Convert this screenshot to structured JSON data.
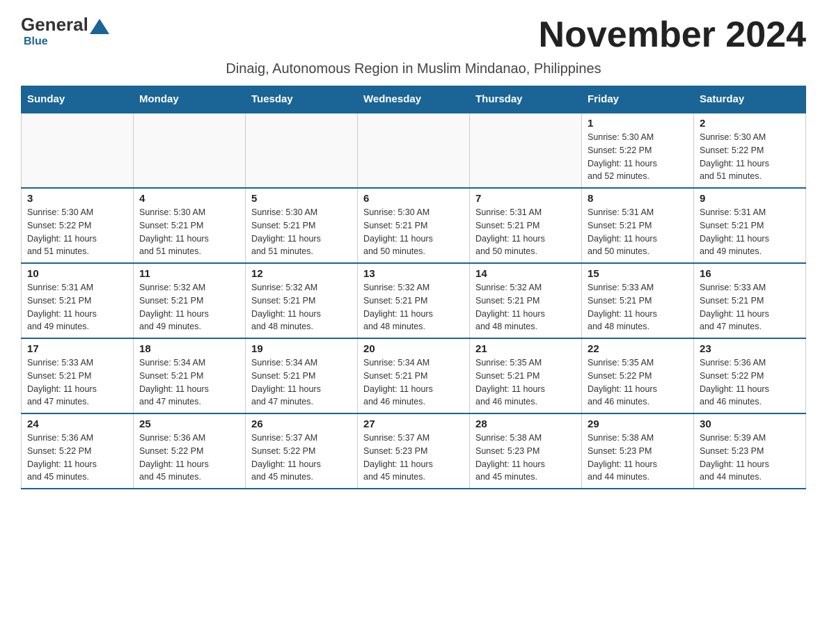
{
  "logo": {
    "general": "General",
    "blue": "Blue"
  },
  "title": "November 2024",
  "subtitle": "Dinaig, Autonomous Region in Muslim Mindanao, Philippines",
  "weekdays": [
    "Sunday",
    "Monday",
    "Tuesday",
    "Wednesday",
    "Thursday",
    "Friday",
    "Saturday"
  ],
  "weeks": [
    [
      {
        "day": "",
        "info": ""
      },
      {
        "day": "",
        "info": ""
      },
      {
        "day": "",
        "info": ""
      },
      {
        "day": "",
        "info": ""
      },
      {
        "day": "",
        "info": ""
      },
      {
        "day": "1",
        "info": "Sunrise: 5:30 AM\nSunset: 5:22 PM\nDaylight: 11 hours\nand 52 minutes."
      },
      {
        "day": "2",
        "info": "Sunrise: 5:30 AM\nSunset: 5:22 PM\nDaylight: 11 hours\nand 51 minutes."
      }
    ],
    [
      {
        "day": "3",
        "info": "Sunrise: 5:30 AM\nSunset: 5:22 PM\nDaylight: 11 hours\nand 51 minutes."
      },
      {
        "day": "4",
        "info": "Sunrise: 5:30 AM\nSunset: 5:21 PM\nDaylight: 11 hours\nand 51 minutes."
      },
      {
        "day": "5",
        "info": "Sunrise: 5:30 AM\nSunset: 5:21 PM\nDaylight: 11 hours\nand 51 minutes."
      },
      {
        "day": "6",
        "info": "Sunrise: 5:30 AM\nSunset: 5:21 PM\nDaylight: 11 hours\nand 50 minutes."
      },
      {
        "day": "7",
        "info": "Sunrise: 5:31 AM\nSunset: 5:21 PM\nDaylight: 11 hours\nand 50 minutes."
      },
      {
        "day": "8",
        "info": "Sunrise: 5:31 AM\nSunset: 5:21 PM\nDaylight: 11 hours\nand 50 minutes."
      },
      {
        "day": "9",
        "info": "Sunrise: 5:31 AM\nSunset: 5:21 PM\nDaylight: 11 hours\nand 49 minutes."
      }
    ],
    [
      {
        "day": "10",
        "info": "Sunrise: 5:31 AM\nSunset: 5:21 PM\nDaylight: 11 hours\nand 49 minutes."
      },
      {
        "day": "11",
        "info": "Sunrise: 5:32 AM\nSunset: 5:21 PM\nDaylight: 11 hours\nand 49 minutes."
      },
      {
        "day": "12",
        "info": "Sunrise: 5:32 AM\nSunset: 5:21 PM\nDaylight: 11 hours\nand 48 minutes."
      },
      {
        "day": "13",
        "info": "Sunrise: 5:32 AM\nSunset: 5:21 PM\nDaylight: 11 hours\nand 48 minutes."
      },
      {
        "day": "14",
        "info": "Sunrise: 5:32 AM\nSunset: 5:21 PM\nDaylight: 11 hours\nand 48 minutes."
      },
      {
        "day": "15",
        "info": "Sunrise: 5:33 AM\nSunset: 5:21 PM\nDaylight: 11 hours\nand 48 minutes."
      },
      {
        "day": "16",
        "info": "Sunrise: 5:33 AM\nSunset: 5:21 PM\nDaylight: 11 hours\nand 47 minutes."
      }
    ],
    [
      {
        "day": "17",
        "info": "Sunrise: 5:33 AM\nSunset: 5:21 PM\nDaylight: 11 hours\nand 47 minutes."
      },
      {
        "day": "18",
        "info": "Sunrise: 5:34 AM\nSunset: 5:21 PM\nDaylight: 11 hours\nand 47 minutes."
      },
      {
        "day": "19",
        "info": "Sunrise: 5:34 AM\nSunset: 5:21 PM\nDaylight: 11 hours\nand 47 minutes."
      },
      {
        "day": "20",
        "info": "Sunrise: 5:34 AM\nSunset: 5:21 PM\nDaylight: 11 hours\nand 46 minutes."
      },
      {
        "day": "21",
        "info": "Sunrise: 5:35 AM\nSunset: 5:21 PM\nDaylight: 11 hours\nand 46 minutes."
      },
      {
        "day": "22",
        "info": "Sunrise: 5:35 AM\nSunset: 5:22 PM\nDaylight: 11 hours\nand 46 minutes."
      },
      {
        "day": "23",
        "info": "Sunrise: 5:36 AM\nSunset: 5:22 PM\nDaylight: 11 hours\nand 46 minutes."
      }
    ],
    [
      {
        "day": "24",
        "info": "Sunrise: 5:36 AM\nSunset: 5:22 PM\nDaylight: 11 hours\nand 45 minutes."
      },
      {
        "day": "25",
        "info": "Sunrise: 5:36 AM\nSunset: 5:22 PM\nDaylight: 11 hours\nand 45 minutes."
      },
      {
        "day": "26",
        "info": "Sunrise: 5:37 AM\nSunset: 5:22 PM\nDaylight: 11 hours\nand 45 minutes."
      },
      {
        "day": "27",
        "info": "Sunrise: 5:37 AM\nSunset: 5:23 PM\nDaylight: 11 hours\nand 45 minutes."
      },
      {
        "day": "28",
        "info": "Sunrise: 5:38 AM\nSunset: 5:23 PM\nDaylight: 11 hours\nand 45 minutes."
      },
      {
        "day": "29",
        "info": "Sunrise: 5:38 AM\nSunset: 5:23 PM\nDaylight: 11 hours\nand 44 minutes."
      },
      {
        "day": "30",
        "info": "Sunrise: 5:39 AM\nSunset: 5:23 PM\nDaylight: 11 hours\nand 44 minutes."
      }
    ]
  ]
}
